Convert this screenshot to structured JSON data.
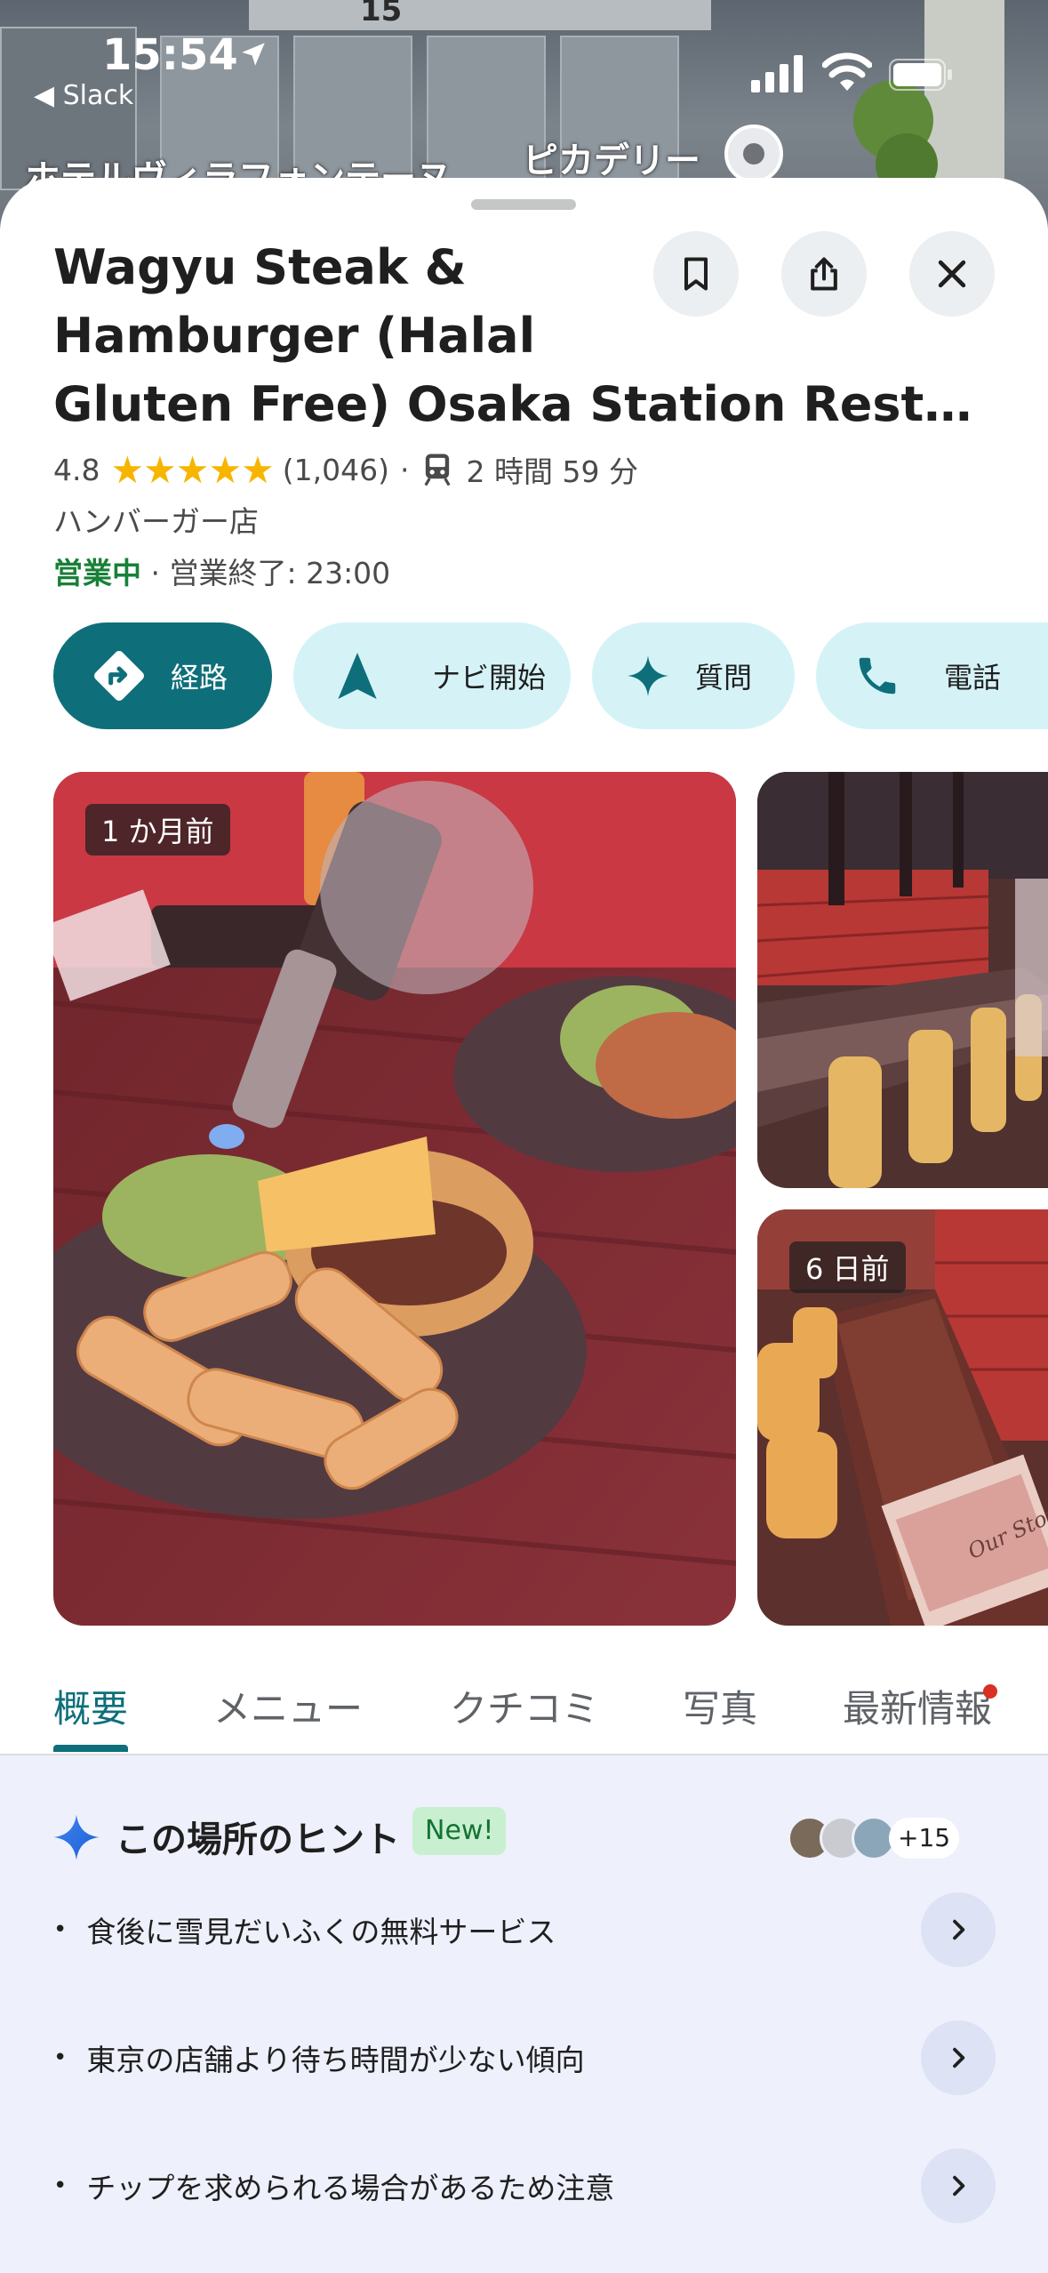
{
  "status_bar": {
    "time": "15:54",
    "back_app": "◀ Slack"
  },
  "map": {
    "block_number": "15",
    "label_left": "ホテルヴィラフォンテーヌ",
    "label_right": "ピカデリー"
  },
  "place": {
    "title_lines": [
      "Wagyu Steak &",
      "Hamburger (Halal",
      "Gluten Free) Osaka Station Restaura..."
    ],
    "rating": "4.8",
    "stars": "★★★★★",
    "review_count": "(1,046)",
    "separator": "·",
    "transit_time": "2 時間 59 分",
    "category": "ハンバーガー店",
    "open_status": "営業中",
    "closing": " · 営業終了: 23:00"
  },
  "actions": [
    {
      "label": "経路",
      "icon": "directions-icon"
    },
    {
      "label": "ナビ開始",
      "icon": "navigation-arrow-icon"
    },
    {
      "label": "質問",
      "icon": "sparkle-icon"
    },
    {
      "label": "電話",
      "icon": "phone-icon"
    }
  ],
  "photos": {
    "main_badge": "1 か月前",
    "side_badge": "6 日前",
    "menu_caption": "Our Story"
  },
  "tabs": [
    "概要",
    "メニュー",
    "クチコミ",
    "写真",
    "最新情報"
  ],
  "hints": {
    "title": "この場所のヒント",
    "new_badge": "New!",
    "contributors_more": "+15",
    "items": [
      "食後に雪見だいふくの無料サービス",
      "東京の店舗より待ち時間が少ない傾向",
      "チップを求められる場合があるため注意"
    ]
  },
  "colors": {
    "accent": "#0e6f7a",
    "pill_bg": "#d5f3f7",
    "open_green": "#188038",
    "star": "#f7b500",
    "hint_bg": "#eef0fb"
  }
}
